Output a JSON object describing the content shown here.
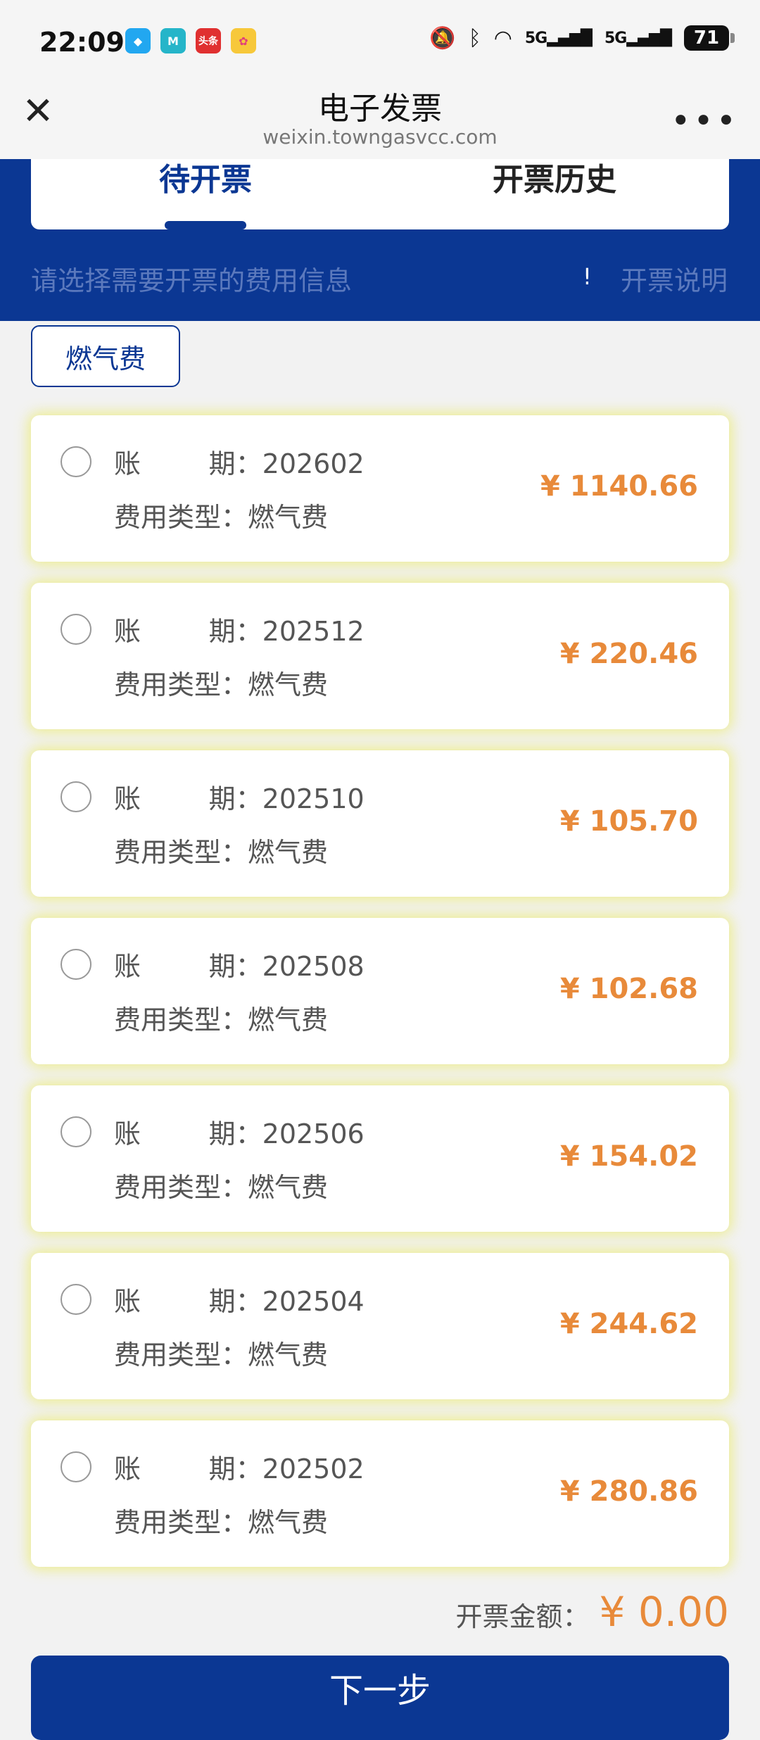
{
  "status_bar": {
    "time": "22:09",
    "app_icons": [
      "qq-icon",
      "m-app-icon",
      "toutiao-icon",
      "flower-app-icon"
    ],
    "toutiao_text": "头条",
    "signal1": "5G",
    "signal2": "5G",
    "battery": "71"
  },
  "nav": {
    "title": "电子发票",
    "subtitle": "weixin.towngasvcc.com",
    "close_icon": "close-icon",
    "more_icon": "more-icon"
  },
  "tabs": [
    {
      "label": "待开票",
      "active": true
    },
    {
      "label": "开票历史",
      "active": false
    }
  ],
  "hint": "请选择需要开票的费用信息",
  "exclaim": "!",
  "explain_link": "开票说明",
  "filter_chip": "燃气费",
  "labels": {
    "period": "账        期：",
    "type": "费用类型："
  },
  "bills": [
    {
      "period": "202602",
      "type": "燃气费",
      "amount": "¥ 1140.66"
    },
    {
      "period": "202512",
      "type": "燃气费",
      "amount": "¥ 220.46"
    },
    {
      "period": "202510",
      "type": "燃气费",
      "amount": "¥ 105.70"
    },
    {
      "period": "202508",
      "type": "燃气费",
      "amount": "¥ 102.68"
    },
    {
      "period": "202506",
      "type": "燃气费",
      "amount": "¥ 154.02"
    },
    {
      "period": "202504",
      "type": "燃气费",
      "amount": "¥ 244.62"
    },
    {
      "period": "202502",
      "type": "燃气费",
      "amount": "¥ 280.86"
    }
  ],
  "total": {
    "label": "开票金额：",
    "amount": "¥ 0.00"
  },
  "next_button": "下一步",
  "colors": {
    "primary": "#0b3793",
    "amount": "#e88a3a",
    "hint": "#5b79bd"
  }
}
